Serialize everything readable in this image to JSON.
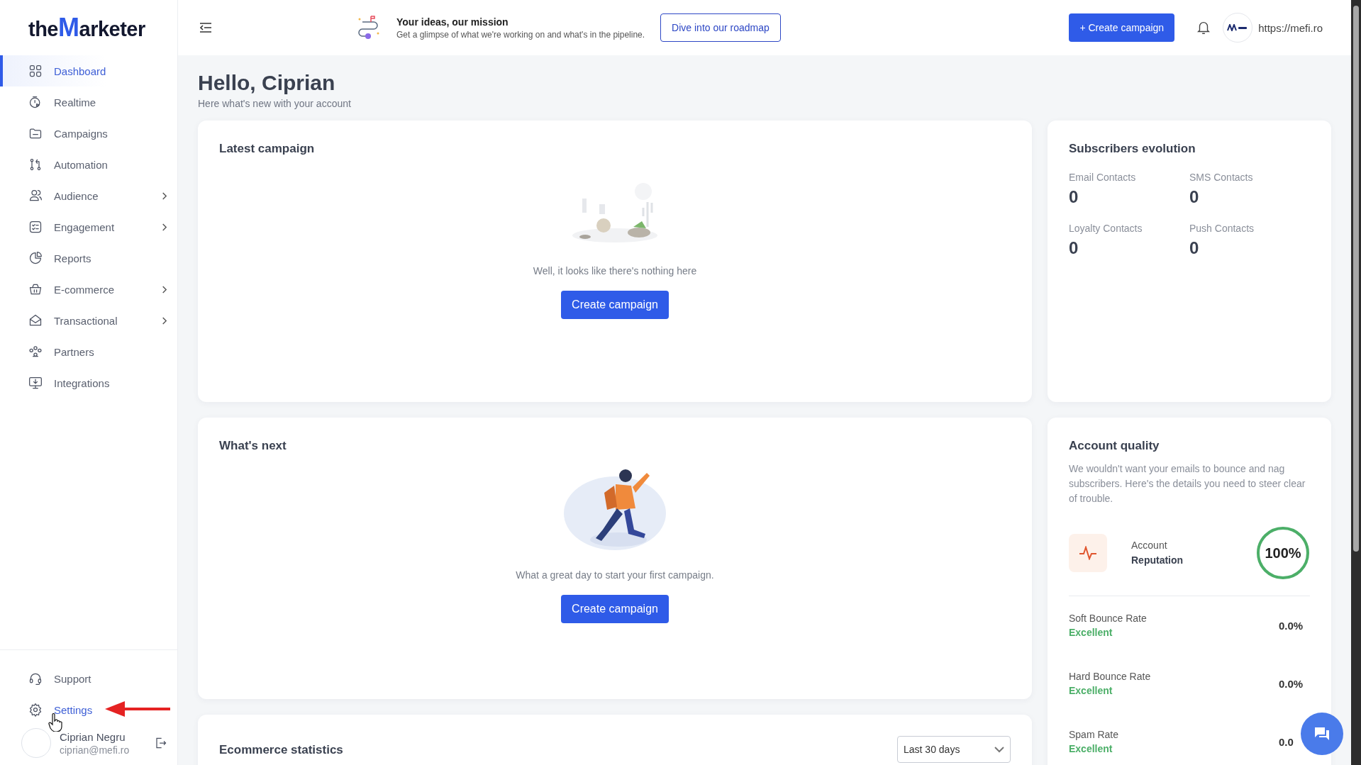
{
  "logo": {
    "prefix": "the",
    "mark": "M",
    "suffix": "arketer"
  },
  "sidebar": {
    "items": [
      {
        "label": "Dashboard",
        "kind": "grid",
        "selected": true,
        "expandable": false
      },
      {
        "label": "Realtime",
        "kind": "timer",
        "selected": false,
        "expandable": false
      },
      {
        "label": "Campaigns",
        "kind": "folder",
        "selected": false,
        "expandable": false
      },
      {
        "label": "Automation",
        "kind": "flow",
        "selected": false,
        "expandable": false
      },
      {
        "label": "Audience",
        "kind": "users",
        "selected": false,
        "expandable": true
      },
      {
        "label": "Engagement",
        "kind": "checklist",
        "selected": false,
        "expandable": true
      },
      {
        "label": "Reports",
        "kind": "pie",
        "selected": false,
        "expandable": false
      },
      {
        "label": "E-commerce",
        "kind": "basket",
        "selected": false,
        "expandable": true
      },
      {
        "label": "Transactional",
        "kind": "envelope",
        "selected": false,
        "expandable": true
      },
      {
        "label": "Partners",
        "kind": "people",
        "selected": false,
        "expandable": false
      },
      {
        "label": "Integrations",
        "kind": "monitor",
        "selected": false,
        "expandable": false
      }
    ],
    "bottom_items": [
      {
        "label": "Support",
        "kind": "headset",
        "selected": false
      },
      {
        "label": "Settings",
        "kind": "gear",
        "selected": true
      }
    ],
    "user": {
      "name": "Ciprian Negru",
      "email": "ciprian@mefi.ro"
    }
  },
  "topbar": {
    "announcement": {
      "title": "Your ideas, our mission",
      "text": "Get a glimpse of what we're working on and what's in the pipeline."
    },
    "roadmap_button": "Dive into our roadmap",
    "create_button": "+ Create campaign",
    "site": "https://mefi.ro"
  },
  "greeting": {
    "title": "Hello, Ciprian",
    "subtitle": "Here what's new with your account"
  },
  "latest_campaign": {
    "title": "Latest campaign",
    "empty_text": "Well, it looks like there's nothing here",
    "button": "Create campaign"
  },
  "subscribers": {
    "title": "Subscribers evolution",
    "stats": [
      {
        "label": "Email Contacts",
        "value": "0"
      },
      {
        "label": "SMS Contacts",
        "value": "0"
      },
      {
        "label": "Loyalty Contacts",
        "value": "0"
      },
      {
        "label": "Push Contacts",
        "value": "0"
      }
    ]
  },
  "whats_next": {
    "title": "What's next",
    "text": "What a great day to start your first campaign.",
    "button": "Create campaign"
  },
  "account_quality": {
    "title": "Account quality",
    "description": "We wouldn't want your emails to bounce and nag subscribers. Here's the details you need to steer clear of trouble.",
    "reputation": {
      "label": "Account",
      "strong": "Reputation",
      "value": "100%",
      "level": 1
    },
    "rates": [
      {
        "name": "Soft Bounce Rate",
        "status": "Excellent",
        "value": "0.0%"
      },
      {
        "name": "Hard Bounce Rate",
        "status": "Excellent",
        "value": "0.0%"
      },
      {
        "name": "Spam Rate",
        "status": "Excellent",
        "value": "0.0"
      }
    ]
  },
  "ecommerce": {
    "title": "Ecommerce statistics",
    "period": "Last 30 days"
  }
}
